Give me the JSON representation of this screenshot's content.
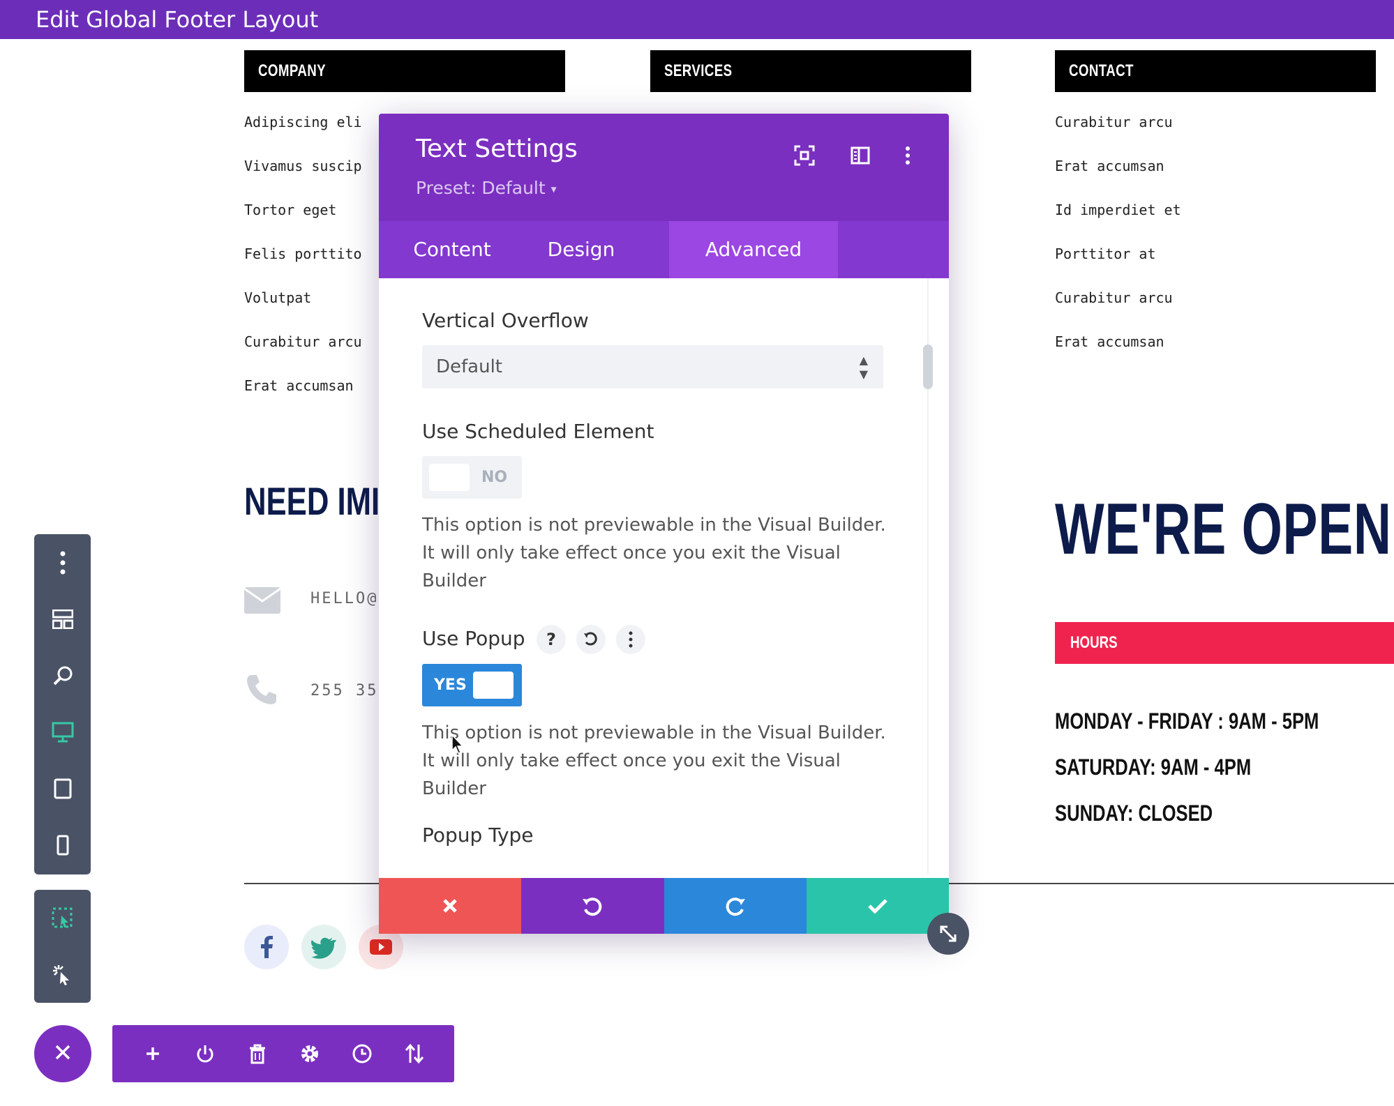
{
  "topbar": {
    "title": "Edit Global Footer Layout"
  },
  "footer": {
    "columns": [
      {
        "header": "COMPANY",
        "links": [
          "Adipiscing eli",
          "Vivamus suscip",
          "Tortor eget",
          "Felis porttito",
          "Volutpat",
          "Curabitur arcu",
          "Erat accumsan"
        ]
      },
      {
        "header": "SERVICES",
        "links": []
      },
      {
        "header": "CONTACT",
        "links": [
          "Curabitur arcu",
          "Erat accumsan",
          "Id imperdiet et",
          "Porttitor at",
          "Curabitur arcu",
          "Erat accumsan"
        ]
      }
    ],
    "need_heading": "NEED IMI",
    "email_text": "HELLO@",
    "phone_text": "255 35",
    "open_heading": "WE'RE OPEN",
    "hours_label": "HOURS",
    "hours_lines": [
      "MONDAY - FRIDAY : 9AM - 5PM",
      "SATURDAY: 9AM - 4PM",
      "SUNDAY: CLOSED"
    ],
    "social": [
      "f",
      "t",
      "yt"
    ]
  },
  "modal": {
    "title": "Text Settings",
    "preset": "Preset: Default",
    "tabs": [
      "Content",
      "Design",
      "Advanced"
    ],
    "active_tab": "Advanced",
    "fields": {
      "vertical_overflow_label": "Vertical Overflow",
      "vertical_overflow_value": "Default",
      "scheduled_label": "Use Scheduled Element",
      "scheduled_value": "NO",
      "scheduled_desc": "This option is not previewable in the Visual Builder. It will only take effect once you exit the Visual Builder",
      "popup_label": "Use Popup",
      "popup_value": "YES",
      "popup_desc": "This option is not previewable in the Visual Builder. It will only take effect once you exit the Visual Builder",
      "popup_type_label": "Popup Type"
    },
    "help_icon_text": "?"
  },
  "colors": {
    "brand_purple": "#7b2fc0",
    "topbar_purple": "#6c2eb9",
    "cancel_red": "#ef5555",
    "undo_purple": "#7b2fc0",
    "redo_blue": "#2b87da",
    "save_green": "#29c4a9",
    "hours_red": "#f0234e",
    "heading_navy": "#0d1b4b"
  },
  "icons": {
    "left_toolbar": [
      "more-icon",
      "layers-icon",
      "zoom-icon",
      "desktop-icon",
      "tablet-icon",
      "phone-icon"
    ],
    "left_toolbar2": [
      "select-icon",
      "click-mode-icon"
    ],
    "bottom_bar": [
      "add-icon",
      "power-icon",
      "trash-icon",
      "gear-icon",
      "history-icon",
      "sort-icon"
    ]
  }
}
